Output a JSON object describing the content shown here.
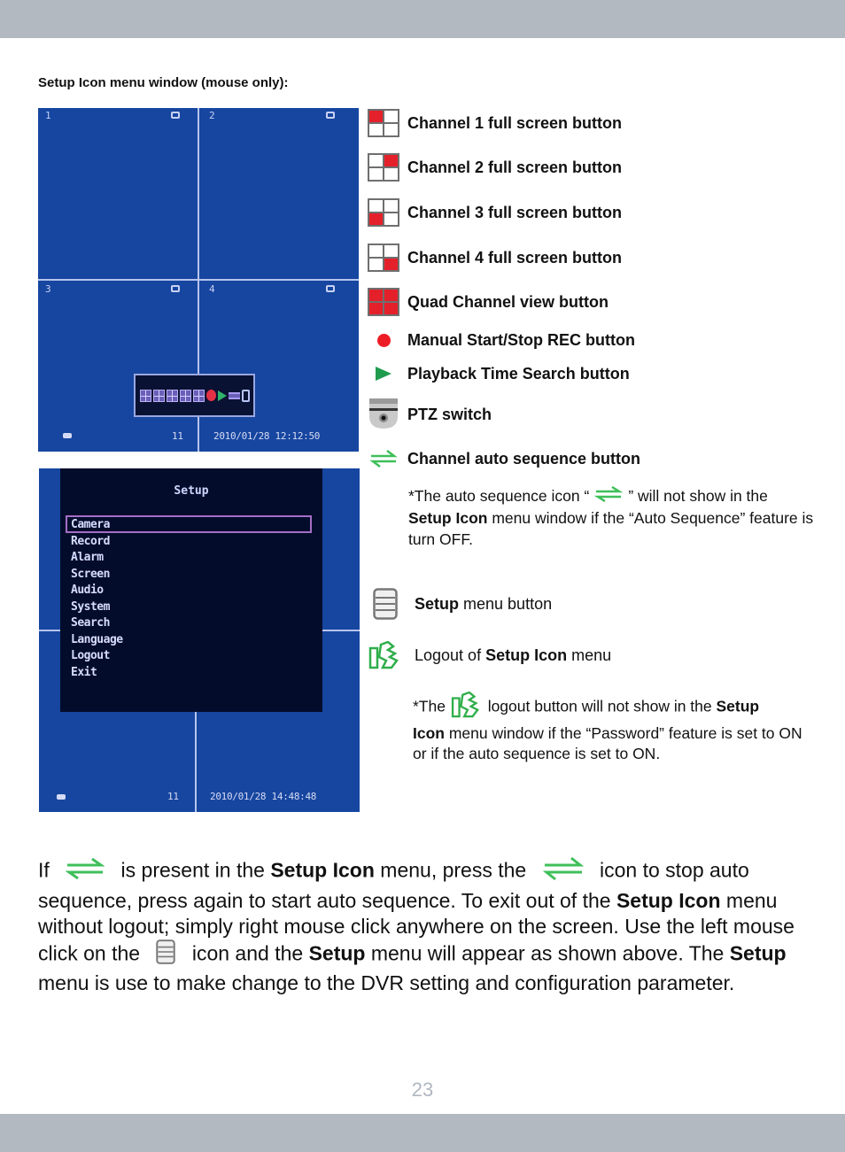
{
  "page": {
    "section_title": "Setup Icon menu window (mouse only):",
    "page_number": "23",
    "colors": {
      "header_bar": "#b3b9c1",
      "dvr_background": "#1646a0",
      "accent_red": "#e4202a",
      "accent_green": "#1f9b4e",
      "page_number": "#b0b7c0"
    }
  },
  "dvr_quad_screen": {
    "channels": [
      "1",
      "2",
      "3",
      "4"
    ],
    "status_count": "11",
    "timestamp": "2010/01/28 12:12:50",
    "toolbar_icons": [
      "channel-1-icon",
      "channel-2-icon",
      "channel-3-icon",
      "channel-4-icon",
      "quad-icon",
      "record-icon",
      "play-icon",
      "sequence-icon",
      "menu-icon"
    ]
  },
  "dvr_setup_screen": {
    "title": "Setup",
    "selected_item": "Camera",
    "menu_items": [
      "Camera",
      "Record",
      "Alarm",
      "Screen",
      "Audio",
      "System",
      "Search",
      "Language",
      "Logout",
      "Exit"
    ],
    "status_count": "11",
    "timestamp": "2010/01/28 14:48:48"
  },
  "legend": [
    {
      "icon": "channel-1-grid-icon",
      "label": "Channel 1 full screen button"
    },
    {
      "icon": "channel-2-grid-icon",
      "label": "Channel 2 full screen button"
    },
    {
      "icon": "channel-3-grid-icon",
      "label": "Channel 3 full screen button"
    },
    {
      "icon": "channel-4-grid-icon",
      "label": "Channel 4 full screen button"
    },
    {
      "icon": "quad-grid-icon",
      "label": "Quad Channel view button"
    },
    {
      "icon": "record-dot-icon",
      "label": "Manual Start/Stop REC button"
    },
    {
      "icon": "play-triangle-icon",
      "label": "Playback Time Search button"
    },
    {
      "icon": "ptz-camera-icon",
      "label": "PTZ switch"
    },
    {
      "icon": "auto-sequence-arrows-icon",
      "label": "Channel auto sequence button"
    }
  ],
  "auto_sequence_note": {
    "part1": "*The auto sequence icon “",
    "part2": "” will not show in the",
    "bold1": "Setup Icon",
    "part3": " menu window if the “Auto Sequence” feature is turn OFF."
  },
  "setup_menu_button": {
    "bold": "Setup",
    "text": " menu button"
  },
  "logout_item": {
    "text1": "Logout of ",
    "bold": "Setup Icon",
    "text2": " menu"
  },
  "logout_note": {
    "part1": "*The ",
    "part2": " logout button will not show in the ",
    "bold1": "Setup",
    "bold2": "Icon",
    "part3": " menu window if the “Password” feature is set to ON or if the auto sequence is set to ON."
  },
  "body_paragraph": {
    "s1": "If ",
    "s2": " is present in the ",
    "b1": "Setup Icon",
    "s3": " menu, press the ",
    "s4": " icon to stop auto sequence, press again to start auto sequence.  To exit out of the ",
    "b2": "Setup Icon",
    "s5": " menu without logout; simply right mouse click anywhere on the screen.  Use the left mouse click on the ",
    "s6": " icon and the ",
    "b3": "Setup",
    "s7": " menu will appear as shown above. The ",
    "b4": "Setup",
    "s8": " menu is use to make change to the DVR setting and configuration parameter."
  }
}
